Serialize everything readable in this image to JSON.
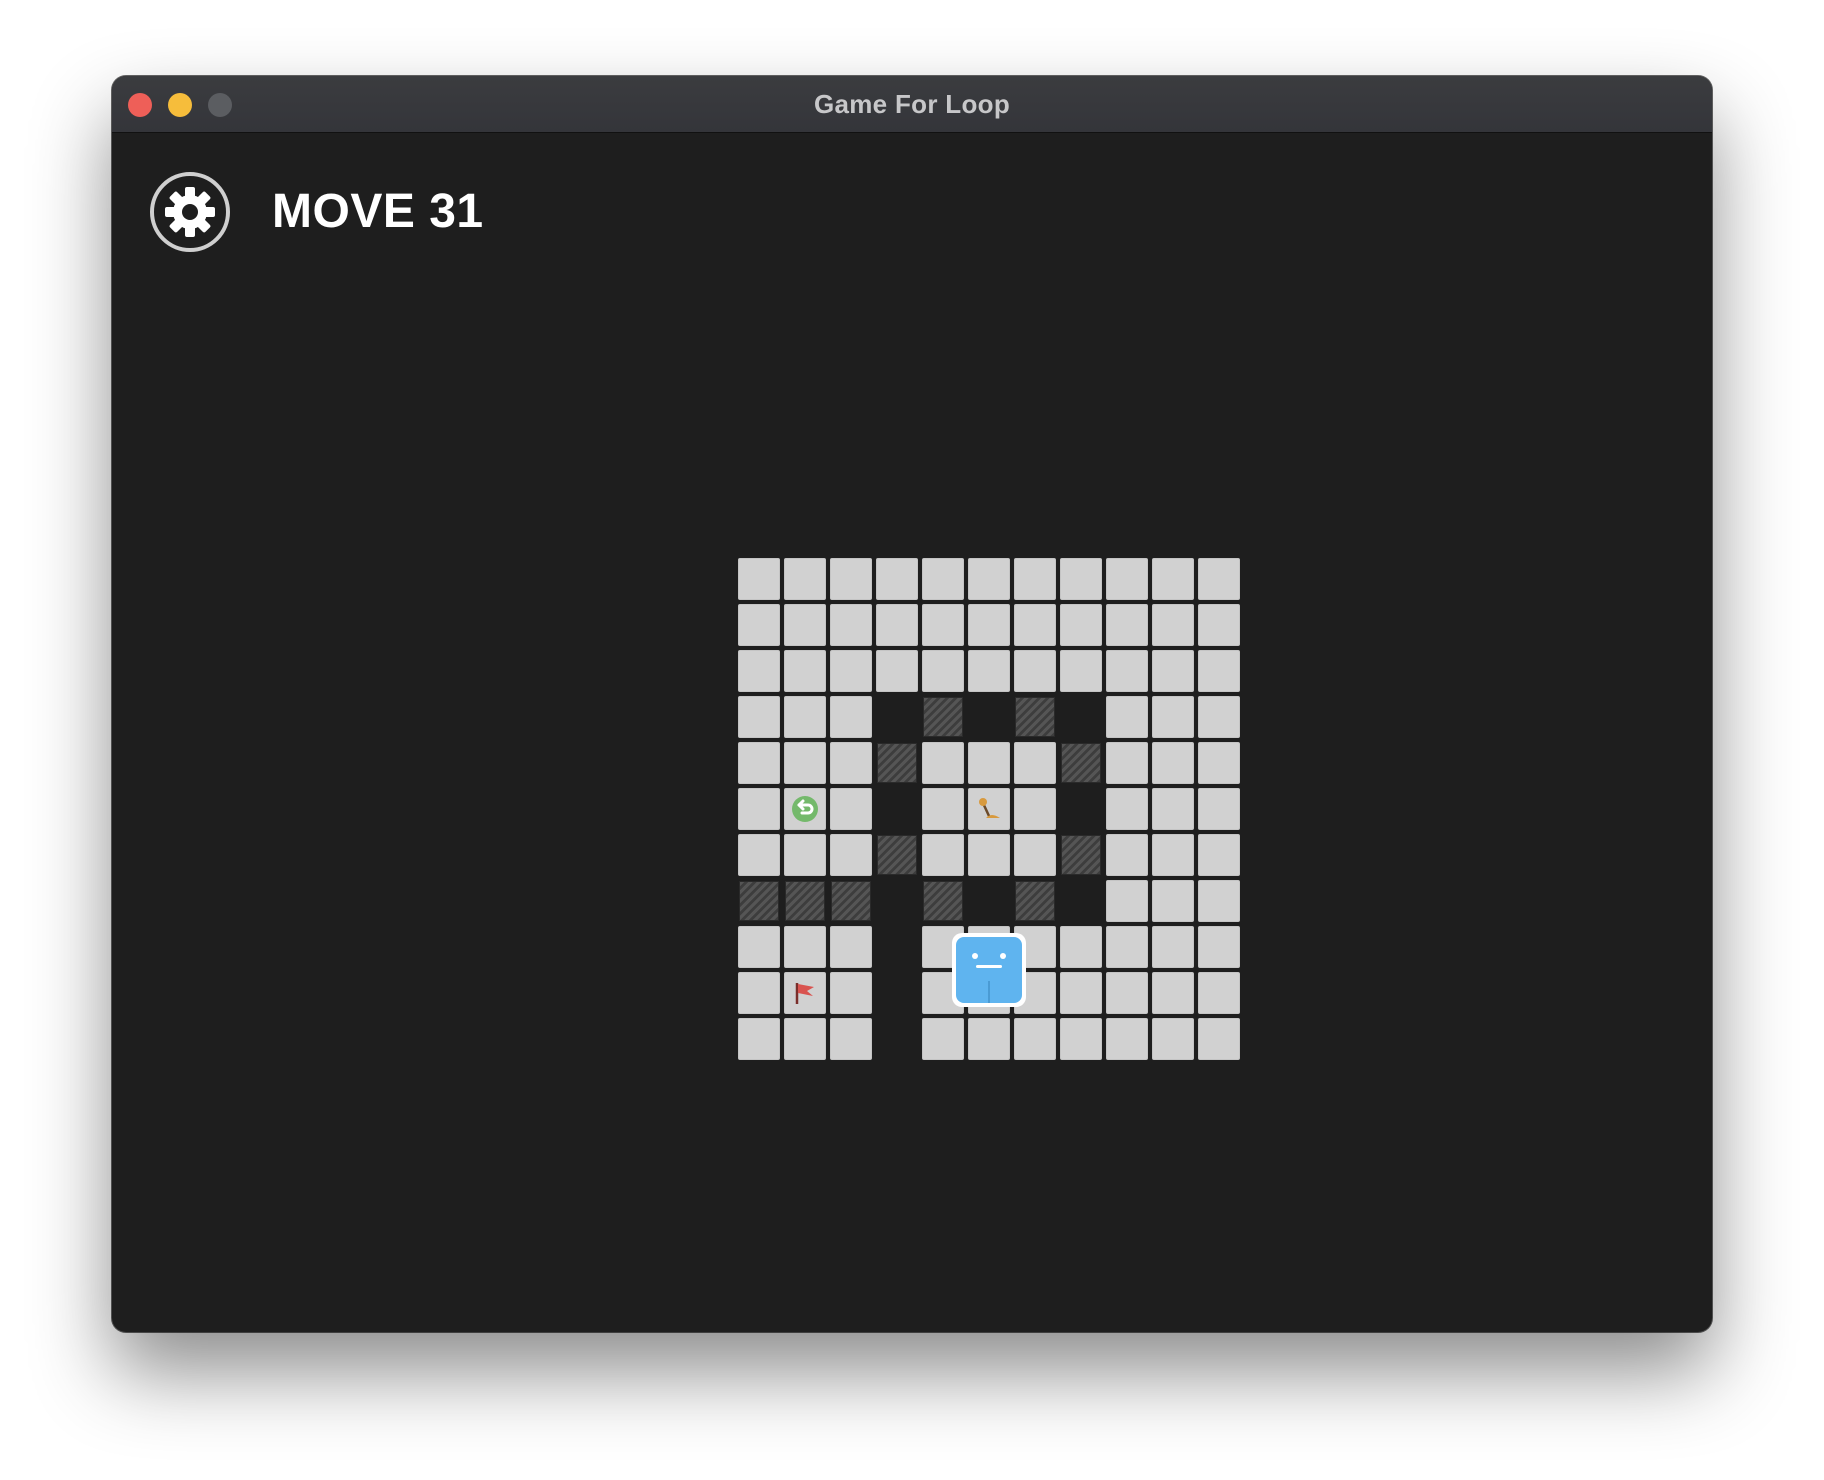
{
  "window": {
    "title": "Game For Loop"
  },
  "hud": {
    "move_label": "MOVE 31",
    "settings_icon": "gear-icon"
  },
  "board": {
    "rows": 11,
    "cols": 11,
    "legend": {
      ".": "floor",
      "#": "wall",
      " ": "empty",
      "R": "loop-return",
      "K": "lever",
      "F": "goal-flag",
      "P": "player"
    },
    "layout": [
      "...........",
      "...........",
      "...........",
      "... # # ...",
      "...#...#...",
      ".R. .K. ...",
      "...#...#...",
      "### # # ...",
      "... .P.....",
      ".F. .......",
      "... ......."
    ],
    "player_size_cells": 1.5,
    "colors": {
      "floor": "#d1d1d1",
      "wall": "#4a4a4a",
      "player": "#5fb4ef",
      "return_icon": "#74b96b",
      "flag": "#d9534f",
      "lever": "#d89a3e"
    }
  }
}
